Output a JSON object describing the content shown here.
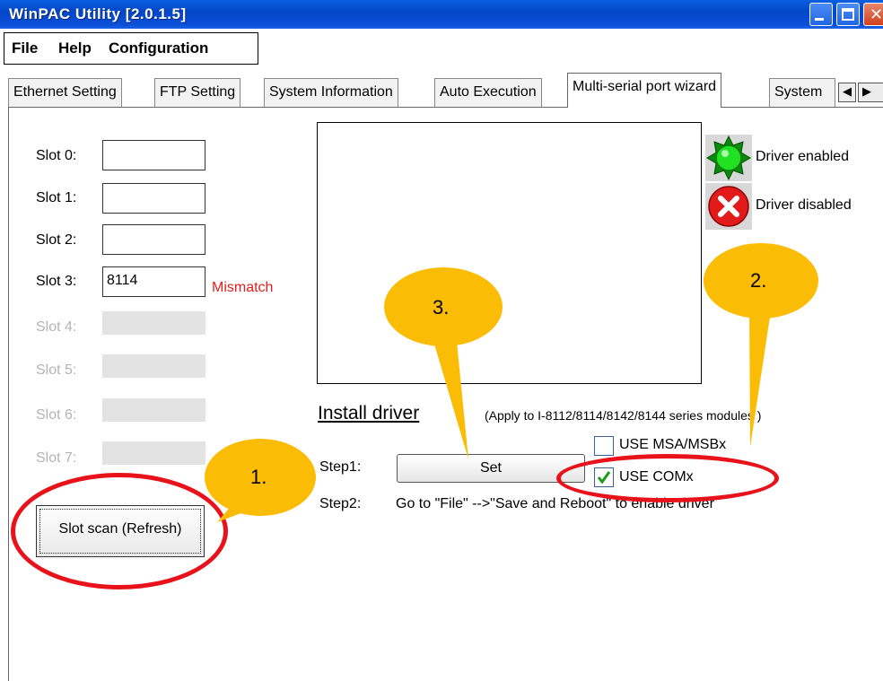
{
  "window": {
    "title": "WinPAC Utility [2.0.1.5]"
  },
  "menu": {
    "file": "File",
    "help": "Help",
    "configuration": "Configuration"
  },
  "tabs": [
    {
      "label": "Ethernet Setting"
    },
    {
      "label": "FTP Setting"
    },
    {
      "label": "System Information"
    },
    {
      "label": "Auto Execution"
    },
    {
      "label": "Multi-serial port wizard",
      "active": true
    },
    {
      "label": "System"
    }
  ],
  "slots": [
    {
      "label": "Slot 0:",
      "value": "",
      "enabled": true
    },
    {
      "label": "Slot 1:",
      "value": "",
      "enabled": true
    },
    {
      "label": "Slot 2:",
      "value": "",
      "enabled": true
    },
    {
      "label": "Slot 3:",
      "value": "8114",
      "enabled": true,
      "status": "Mismatch"
    },
    {
      "label": "Slot 4:",
      "value": "",
      "enabled": false
    },
    {
      "label": "Slot 5:",
      "value": "",
      "enabled": false
    },
    {
      "label": "Slot 6:",
      "value": "",
      "enabled": false
    },
    {
      "label": "Slot 7:",
      "value": "",
      "enabled": false
    }
  ],
  "legend": {
    "enabled": "Driver enabled",
    "disabled": "Driver disabled"
  },
  "install": {
    "title": "Install driver",
    "note": "(Apply to I-8112/8114/8142/8144 series modules )",
    "step1_label": "Step1:",
    "set_button": "Set",
    "step2_label": "Step2:",
    "step2_text": "Go to \"File\" -->\"Save and Reboot\" to enable driver"
  },
  "options": {
    "use_msa": {
      "label": "USE MSA/MSBx",
      "checked": false
    },
    "use_com": {
      "label": "USE COMx",
      "checked": true
    }
  },
  "slot_scan_button": "Slot scan (Refresh)",
  "callouts": {
    "one": "1.",
    "two": "2.",
    "three": "3."
  },
  "colors": {
    "callout_fill": "#fbbc06",
    "ring": "#e8121b",
    "mismatch": "#e02020",
    "titlebar": "#0446c8"
  }
}
